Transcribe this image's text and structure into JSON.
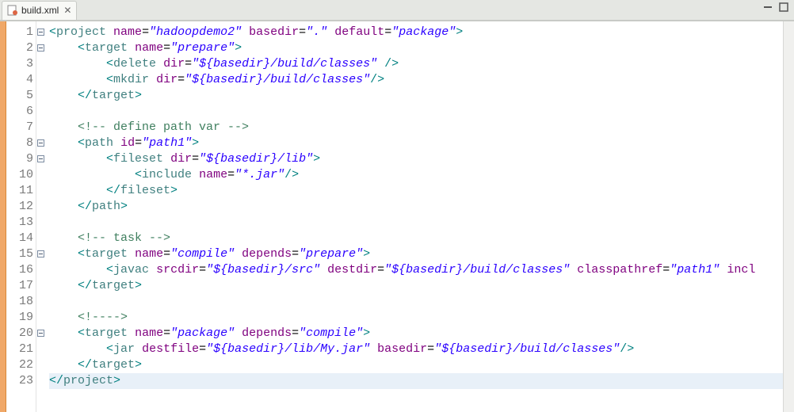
{
  "tab": {
    "filename": "build.xml",
    "close_glyph": "✕"
  },
  "code": {
    "lines": [
      {
        "n": 1,
        "indent": 0,
        "fold": true,
        "tokens": [
          [
            "punct",
            "<"
          ],
          [
            "tag",
            "project"
          ],
          [
            "plain",
            " "
          ],
          [
            "attr",
            "name"
          ],
          [
            "plain",
            "="
          ],
          [
            "str",
            "\"hadoopdemo2\""
          ],
          [
            "plain",
            " "
          ],
          [
            "attr",
            "basedir"
          ],
          [
            "plain",
            "="
          ],
          [
            "str",
            "\".\""
          ],
          [
            "plain",
            " "
          ],
          [
            "attr",
            "default"
          ],
          [
            "plain",
            "="
          ],
          [
            "str",
            "\"package\""
          ],
          [
            "punct",
            ">"
          ]
        ]
      },
      {
        "n": 2,
        "indent": 1,
        "fold": true,
        "tokens": [
          [
            "punct",
            "<"
          ],
          [
            "tag",
            "target"
          ],
          [
            "plain",
            " "
          ],
          [
            "attr",
            "name"
          ],
          [
            "plain",
            "="
          ],
          [
            "str",
            "\"prepare\""
          ],
          [
            "punct",
            ">"
          ]
        ]
      },
      {
        "n": 3,
        "indent": 2,
        "fold": false,
        "tokens": [
          [
            "punct",
            "<"
          ],
          [
            "tag",
            "delete"
          ],
          [
            "plain",
            " "
          ],
          [
            "attr",
            "dir"
          ],
          [
            "plain",
            "="
          ],
          [
            "str",
            "\"${basedir}/build/classes\""
          ],
          [
            "plain",
            " "
          ],
          [
            "punct",
            "/>"
          ]
        ]
      },
      {
        "n": 4,
        "indent": 2,
        "fold": false,
        "tokens": [
          [
            "punct",
            "<"
          ],
          [
            "tag",
            "mkdir"
          ],
          [
            "plain",
            " "
          ],
          [
            "attr",
            "dir"
          ],
          [
            "plain",
            "="
          ],
          [
            "str",
            "\"${basedir}/build/classes\""
          ],
          [
            "punct",
            "/>"
          ]
        ]
      },
      {
        "n": 5,
        "indent": 1,
        "fold": false,
        "tokens": [
          [
            "punct",
            "</"
          ],
          [
            "tag",
            "target"
          ],
          [
            "punct",
            ">"
          ]
        ]
      },
      {
        "n": 6,
        "indent": 0,
        "fold": false,
        "tokens": []
      },
      {
        "n": 7,
        "indent": 1,
        "fold": false,
        "tokens": [
          [
            "cmt",
            "<!-- define path var -->"
          ]
        ]
      },
      {
        "n": 8,
        "indent": 1,
        "fold": true,
        "tokens": [
          [
            "punct",
            "<"
          ],
          [
            "tag",
            "path"
          ],
          [
            "plain",
            " "
          ],
          [
            "attr",
            "id"
          ],
          [
            "plain",
            "="
          ],
          [
            "str",
            "\"path1\""
          ],
          [
            "punct",
            ">"
          ]
        ]
      },
      {
        "n": 9,
        "indent": 2,
        "fold": true,
        "tokens": [
          [
            "punct",
            "<"
          ],
          [
            "tag",
            "fileset"
          ],
          [
            "plain",
            " "
          ],
          [
            "attr",
            "dir"
          ],
          [
            "plain",
            "="
          ],
          [
            "str",
            "\"${basedir}/lib\""
          ],
          [
            "punct",
            ">"
          ]
        ]
      },
      {
        "n": 10,
        "indent": 3,
        "fold": false,
        "tokens": [
          [
            "punct",
            "<"
          ],
          [
            "tag",
            "include"
          ],
          [
            "plain",
            " "
          ],
          [
            "attr",
            "name"
          ],
          [
            "plain",
            "="
          ],
          [
            "str",
            "\"*.jar\""
          ],
          [
            "punct",
            "/>"
          ]
        ]
      },
      {
        "n": 11,
        "indent": 2,
        "fold": false,
        "tokens": [
          [
            "punct",
            "</"
          ],
          [
            "tag",
            "fileset"
          ],
          [
            "punct",
            ">"
          ]
        ]
      },
      {
        "n": 12,
        "indent": 1,
        "fold": false,
        "tokens": [
          [
            "punct",
            "</"
          ],
          [
            "tag",
            "path"
          ],
          [
            "punct",
            ">"
          ]
        ]
      },
      {
        "n": 13,
        "indent": 0,
        "fold": false,
        "tokens": []
      },
      {
        "n": 14,
        "indent": 1,
        "fold": false,
        "tokens": [
          [
            "cmt",
            "<!-- task -->"
          ]
        ]
      },
      {
        "n": 15,
        "indent": 1,
        "fold": true,
        "tokens": [
          [
            "punct",
            "<"
          ],
          [
            "tag",
            "target"
          ],
          [
            "plain",
            " "
          ],
          [
            "attr",
            "name"
          ],
          [
            "plain",
            "="
          ],
          [
            "str",
            "\"compile\""
          ],
          [
            "plain",
            " "
          ],
          [
            "attr",
            "depends"
          ],
          [
            "plain",
            "="
          ],
          [
            "str",
            "\"prepare\""
          ],
          [
            "punct",
            ">"
          ]
        ]
      },
      {
        "n": 16,
        "indent": 2,
        "fold": false,
        "tokens": [
          [
            "punct",
            "<"
          ],
          [
            "tag",
            "javac"
          ],
          [
            "plain",
            " "
          ],
          [
            "attr",
            "srcdir"
          ],
          [
            "plain",
            "="
          ],
          [
            "str",
            "\"${basedir}/src\""
          ],
          [
            "plain",
            " "
          ],
          [
            "attr",
            "destdir"
          ],
          [
            "plain",
            "="
          ],
          [
            "str",
            "\"${basedir}/build/classes\""
          ],
          [
            "plain",
            " "
          ],
          [
            "attr",
            "classpathref"
          ],
          [
            "plain",
            "="
          ],
          [
            "str",
            "\"path1\""
          ],
          [
            "plain",
            " "
          ],
          [
            "attr",
            "incl"
          ]
        ]
      },
      {
        "n": 17,
        "indent": 1,
        "fold": false,
        "tokens": [
          [
            "punct",
            "</"
          ],
          [
            "tag",
            "target"
          ],
          [
            "punct",
            ">"
          ]
        ]
      },
      {
        "n": 18,
        "indent": 0,
        "fold": false,
        "tokens": []
      },
      {
        "n": 19,
        "indent": 1,
        "fold": false,
        "tokens": [
          [
            "cmt",
            "<!---->"
          ]
        ]
      },
      {
        "n": 20,
        "indent": 1,
        "fold": true,
        "tokens": [
          [
            "punct",
            "<"
          ],
          [
            "tag",
            "target"
          ],
          [
            "plain",
            " "
          ],
          [
            "attr",
            "name"
          ],
          [
            "plain",
            "="
          ],
          [
            "str",
            "\"package\""
          ],
          [
            "plain",
            " "
          ],
          [
            "attr",
            "depends"
          ],
          [
            "plain",
            "="
          ],
          [
            "str",
            "\"compile\""
          ],
          [
            "punct",
            ">"
          ]
        ]
      },
      {
        "n": 21,
        "indent": 2,
        "fold": false,
        "tokens": [
          [
            "punct",
            "<"
          ],
          [
            "tag",
            "jar"
          ],
          [
            "plain",
            " "
          ],
          [
            "attr",
            "destfile"
          ],
          [
            "plain",
            "="
          ],
          [
            "str",
            "\"${basedir}/lib/My.jar\""
          ],
          [
            "plain",
            " "
          ],
          [
            "attr",
            "basedir"
          ],
          [
            "plain",
            "="
          ],
          [
            "str",
            "\"${basedir}/build/classes\""
          ],
          [
            "punct",
            "/>"
          ]
        ]
      },
      {
        "n": 22,
        "indent": 1,
        "fold": false,
        "tokens": [
          [
            "punct",
            "</"
          ],
          [
            "tag",
            "target"
          ],
          [
            "punct",
            ">"
          ]
        ]
      },
      {
        "n": 23,
        "indent": 0,
        "fold": false,
        "sel": true,
        "tokens": [
          [
            "punct",
            "</"
          ],
          [
            "tag",
            "project"
          ],
          [
            "punct",
            ">"
          ]
        ]
      }
    ]
  }
}
